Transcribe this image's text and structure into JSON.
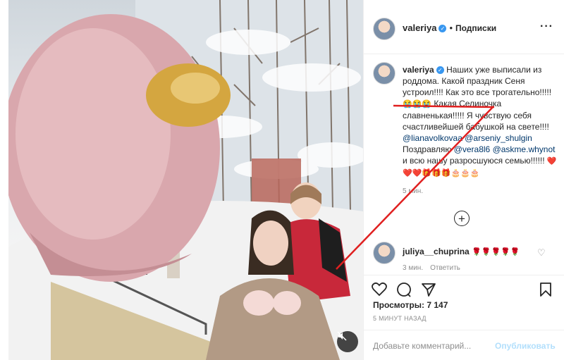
{
  "post": {
    "author": "valeriya",
    "follow_label": "Подписки",
    "separator": "•",
    "more_icon": "more-dots-icon"
  },
  "caption": {
    "author": "valeriya",
    "line1": "Наших уже выписали из роддома. Какой праздник Сеня устроил!!!! Как это все трогательно!!!!!",
    "emoji1": "😭😭😭",
    "line2": " Какая Селиночка славненькая!!!!! Я чувствую себя счастливейшей бабушкой на свете!!!! ",
    "mention1": "@lianavolkovaa",
    "mention2": "@arseniy_shulgin",
    "text3": " Поздравляю ",
    "mention3": "@vera8l6",
    "mention4": "@askme.whynot",
    "text4": " и всю нашу разросшуюся семью!!!!!! ",
    "emoji2": "❤️❤️❤️🎁🎁🎁🎂🎂🎂",
    "time": "5 мин."
  },
  "comment": {
    "author": "juliya__chuprina",
    "emoji": "🌹🌹🌹🌹🌹",
    "time": "3 мин.",
    "reply_label": "Ответить"
  },
  "stats": {
    "views": "Просмотры: 7 147",
    "posted": "5 МИНУТ НАЗАД"
  },
  "add_comment": {
    "placeholder": "Добавьте комментарий...",
    "publish_label": "Опубликовать"
  },
  "colors": {
    "annotation": "#e02020",
    "verified": "#3897f0",
    "link": "#00376b",
    "publish_disabled": "#b2dffc"
  }
}
